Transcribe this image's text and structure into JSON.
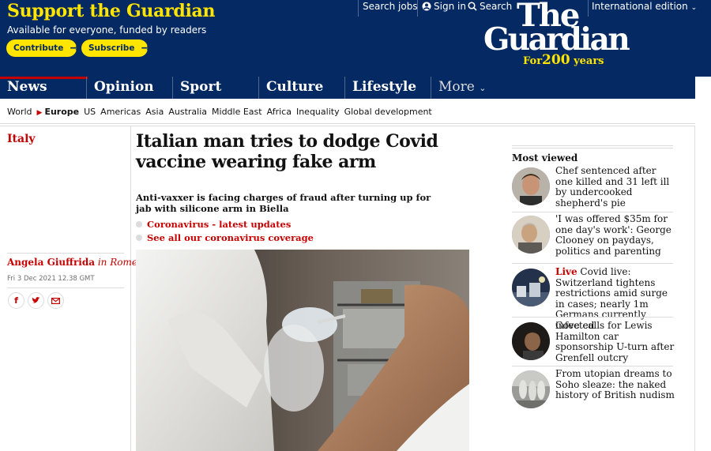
{
  "masthead": {
    "support_title": "Support the Guardian",
    "support_subtitle": "Available for everyone, funded by readers",
    "contribute_label": "Contribute",
    "subscribe_label": "Subscribe",
    "arrow_glyph": "→",
    "search_jobs": "Search jobs",
    "sign_in": "Sign in",
    "search": "Search",
    "edition": "International edition",
    "logo_the": "The",
    "logo_guardian": "Guardian",
    "logo_for": "For",
    "logo_years_num": "200",
    "logo_years": "years",
    "colors": {
      "brand": "#052962",
      "highlight": "#ffe500",
      "news": "#c70000"
    }
  },
  "nav": {
    "pillars": [
      "News",
      "Opinion",
      "Sport",
      "Culture",
      "Lifestyle"
    ],
    "more": "More"
  },
  "subnav": {
    "items": [
      "World",
      "Europe",
      "US",
      "Americas",
      "Asia",
      "Australia",
      "Middle East",
      "Africa",
      "Inequality",
      "Global development"
    ],
    "current": "Europe"
  },
  "article": {
    "section": "Italy",
    "headline": "Italian man tries to dodge Covid vaccine wearing fake arm",
    "standfirst": "Anti-vaxxer is facing charges of fraud after turning up for jab with silicone arm in Biella",
    "related": [
      "Coronavirus - latest updates",
      "See all our coronavirus coverage"
    ],
    "author": "Angela Giuffrida",
    "location_prefix": "in",
    "location": "Rome",
    "date": "Fri 3 Dec 2021 12.38 GMT",
    "share_icons": [
      "facebook-icon",
      "twitter-icon",
      "email-icon"
    ]
  },
  "most_viewed": {
    "title": "Most viewed",
    "items": [
      {
        "live": "",
        "text": "Chef sentenced after one killed and 31 left ill by undercooked shepherd's pie"
      },
      {
        "live": "",
        "text": "'I was offered $35m for one day's work': George Clooney on paydays, politics and parenting"
      },
      {
        "live": "Live",
        "text": " Covid live: Switzerland tightens restrictions amid surge in cases; nearly 1m Germans currently infected"
      },
      {
        "live": "",
        "text": "Gove calls for Lewis Hamilton car sponsorship U-turn after Grenfell outcry"
      },
      {
        "live": "",
        "text": "From utopian dreams to Soho sleaze: the naked history of British nudism"
      }
    ]
  }
}
